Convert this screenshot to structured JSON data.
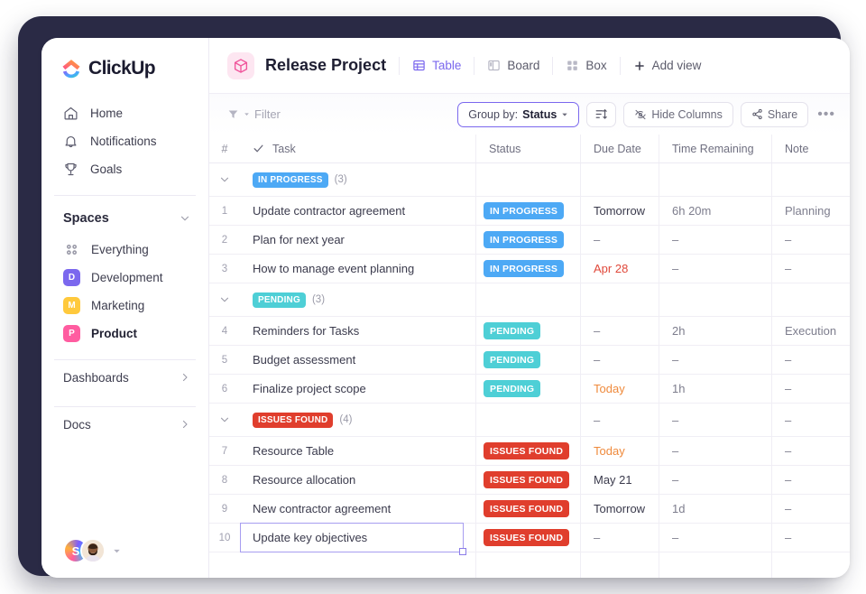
{
  "brand": {
    "name": "ClickUp",
    "accent": "#7b68ee"
  },
  "sidebar": {
    "nav": [
      {
        "label": "Home",
        "icon": "home-icon"
      },
      {
        "label": "Notifications",
        "icon": "bell-icon"
      },
      {
        "label": "Goals",
        "icon": "trophy-icon"
      }
    ],
    "spaces_title": "Spaces",
    "spaces": [
      {
        "label": "Everything",
        "icon": "grid-dots-icon",
        "badge": null,
        "color": null,
        "selected": false
      },
      {
        "label": "Development",
        "icon": null,
        "badge": "D",
        "color": "#7b68ee",
        "selected": false
      },
      {
        "label": "Marketing",
        "icon": null,
        "badge": "M",
        "color": "#ffc93c",
        "selected": false
      },
      {
        "label": "Product",
        "icon": null,
        "badge": "P",
        "color": "#ff5ca0",
        "selected": true
      }
    ],
    "bottom": [
      {
        "label": "Dashboards"
      },
      {
        "label": "Docs"
      }
    ],
    "avatar_initial": "S"
  },
  "header": {
    "project_title": "Release Project",
    "project_icon": "cube-icon",
    "views": [
      {
        "label": "Table",
        "icon": "table-icon",
        "active": true
      },
      {
        "label": "Board",
        "icon": "board-icon",
        "active": false
      },
      {
        "label": "Box",
        "icon": "box-icon",
        "active": false
      }
    ],
    "add_view_label": "Add view"
  },
  "toolbar": {
    "filter_label": "Filter",
    "group_by_prefix": "Group by:",
    "group_by_value": "Status",
    "sort_icon": "sort-icon",
    "hide_columns_label": "Hide Columns",
    "share_label": "Share",
    "more_label": "•••"
  },
  "table": {
    "columns": [
      "#",
      "Task",
      "Status",
      "Due Date",
      "Time Remaining",
      "Note"
    ],
    "groups": [
      {
        "status": "IN PROGRESS",
        "color": "#4da9f5",
        "count": "(3)",
        "header_cells": {
          "due": "",
          "time": "",
          "note": ""
        },
        "rows": [
          {
            "num": "1",
            "task": "Update contractor agreement",
            "status": "IN PROGRESS",
            "due": "Tomorrow",
            "due_style": "normal",
            "time": "6h 20m",
            "note": "Planning"
          },
          {
            "num": "2",
            "task": "Plan for next year",
            "status": "IN PROGRESS",
            "due": "–",
            "due_style": "soft",
            "time": "–",
            "note": "–"
          },
          {
            "num": "3",
            "task": "How to manage event planning",
            "status": "IN PROGRESS",
            "due": "Apr 28",
            "due_style": "red",
            "time": "–",
            "note": "–"
          }
        ]
      },
      {
        "status": "PENDING",
        "color": "#4ecfd6",
        "count": "(3)",
        "header_cells": {
          "due": "",
          "time": "",
          "note": ""
        },
        "rows": [
          {
            "num": "4",
            "task": "Reminders for Tasks",
            "status": "PENDING",
            "due": "–",
            "due_style": "soft",
            "time": "2h",
            "note": "Execution"
          },
          {
            "num": "5",
            "task": "Budget assessment",
            "status": "PENDING",
            "due": "–",
            "due_style": "soft",
            "time": "–",
            "note": "–"
          },
          {
            "num": "6",
            "task": "Finalize project scope",
            "status": "PENDING",
            "due": "Today",
            "due_style": "orange",
            "time": "1h",
            "note": "–"
          }
        ]
      },
      {
        "status": "ISSUES FOUND",
        "color": "#e03e2d",
        "count": "(4)",
        "header_cells": {
          "due": "–",
          "time": "–",
          "note": "–"
        },
        "rows": [
          {
            "num": "7",
            "task": "Resource Table",
            "status": "ISSUES FOUND",
            "due": "Today",
            "due_style": "orange",
            "time": "–",
            "note": "–"
          },
          {
            "num": "8",
            "task": "Resource allocation",
            "status": "ISSUES FOUND",
            "due": "May 21",
            "due_style": "normal",
            "time": "–",
            "note": "–"
          },
          {
            "num": "9",
            "task": "New contractor agreement",
            "status": "ISSUES FOUND",
            "due": "Tomorrow",
            "due_style": "normal",
            "time": "1d",
            "note": "–"
          },
          {
            "num": "10",
            "task": "Update key objectives",
            "status": "ISSUES FOUND",
            "due": "–",
            "due_style": "soft",
            "time": "–",
            "note": "–",
            "selected": true
          }
        ]
      }
    ]
  }
}
